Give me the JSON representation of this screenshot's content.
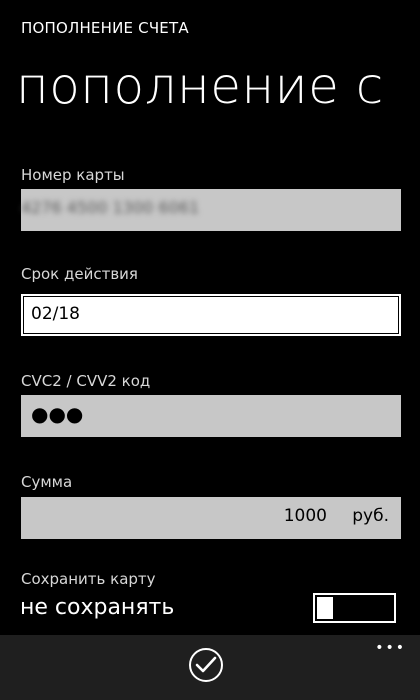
{
  "app_title": "ПОПОЛНЕНИЕ СЧЕТА",
  "page_title": "пополнение с",
  "card_number": {
    "label": "Номер карты",
    "value": "4276 4500 1300 6061"
  },
  "expiry": {
    "label": "Срок действия",
    "value": "02/18"
  },
  "cvc": {
    "label": "CVC2 / CVV2 код",
    "value": "●●●"
  },
  "amount": {
    "label": "Сумма",
    "value": "1000",
    "unit": "руб."
  },
  "save_card": {
    "label": "Сохранить карту",
    "value": "не сохранять",
    "enabled": false
  },
  "appbar": {
    "confirm_icon": "check-icon",
    "more_label": "•••"
  },
  "colors": {
    "background": "#000000",
    "field": "#c7c7c7",
    "appbar": "#1f1f1f"
  }
}
